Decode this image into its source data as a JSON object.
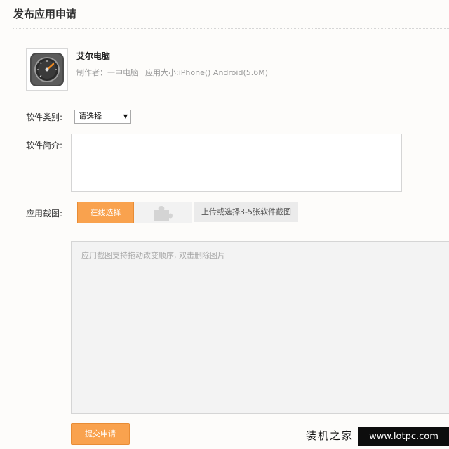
{
  "page": {
    "title": "发布应用申请"
  },
  "app": {
    "icon": "speedometer-icon",
    "name": "艾尔电脑",
    "author": "制作者：一中电脑",
    "size": "应用大小:iPhone() Android(5.6M)"
  },
  "form": {
    "category_label": "软件类别:",
    "category_value": "请选择",
    "intro_label": "软件简介:",
    "screenshots_label": "应用截图:",
    "online_select_label": "在线选择",
    "upload_hint": "上传或选择3-5张软件截图",
    "screenshots_placeholder": "应用截图支持拖动改变顺序, 双击删除图片",
    "submit_label": "提交申请"
  },
  "watermark": {
    "text": "装机之家",
    "url": "www.lotpc.com"
  },
  "colors": {
    "accent": "#f9a24e",
    "background": "#fdfcfa"
  }
}
